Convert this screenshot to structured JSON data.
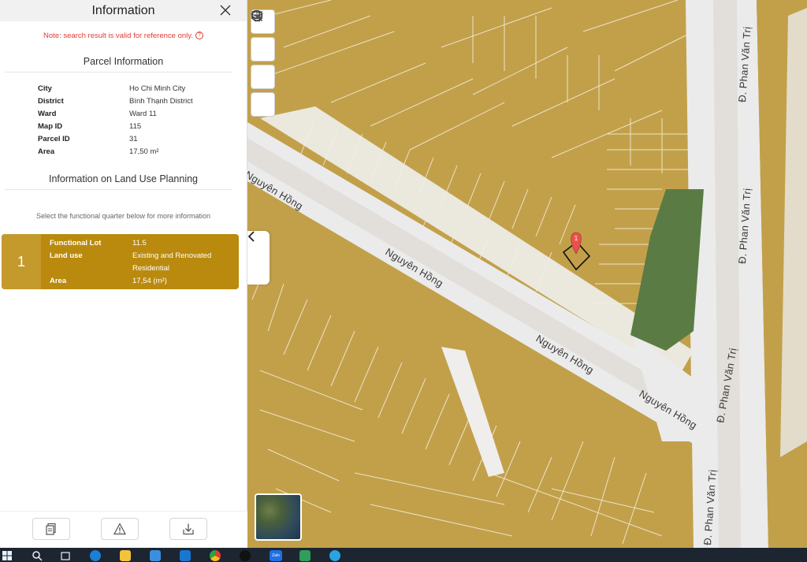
{
  "panel": {
    "title": "Information",
    "note": "Note: search result is valid for reference only.",
    "note_help": "?",
    "parcel_section_title": "Parcel Information",
    "parcel_info": [
      {
        "key": "City",
        "value": "Ho Chi Minh City"
      },
      {
        "key": "District",
        "value": "Bình Thạnh District"
      },
      {
        "key": "Ward",
        "value": "Ward 11"
      },
      {
        "key": "Map ID",
        "value": "115"
      },
      {
        "key": "Parcel ID",
        "value": "31"
      },
      {
        "key": "Area",
        "value": "17,50 m²"
      }
    ],
    "planning_section_title": "Information on Land Use Planning",
    "planning_hint": "Select the functional quarter below for more information",
    "lot": {
      "number": "1",
      "rows": [
        {
          "key": "Functional Lot",
          "value": "11.5"
        },
        {
          "key": "Land use",
          "value": "Existing and Renovated Residential"
        },
        {
          "key": "Area",
          "value": "17,54 (m²)"
        }
      ]
    },
    "footer_buttons": [
      {
        "name": "copy-document-button",
        "icon": "document-icon"
      },
      {
        "name": "report-issue-button",
        "icon": "warning-icon"
      },
      {
        "name": "download-button",
        "icon": "download-icon"
      }
    ]
  },
  "map": {
    "street_labels": [
      "Nguyên Hồng",
      "Nguyên Hồng",
      "Nguyên Hồng",
      "Nguyên Hồng",
      "Đ. Phan Văn Trị",
      "Đ. Phan Văn Trị",
      "Đ. Phan Văn Trị",
      "Đ. Phan Văn Trị"
    ],
    "marker_label": "1",
    "tools": [
      "search-icon",
      "layers-icon",
      "list-icon",
      "info-icon"
    ],
    "colors": {
      "land_residential": "#c2a04a",
      "road": "#ebebeb",
      "green_space": "#5b7b45",
      "marker": "#e8524b",
      "lot_card": "#b98a0d",
      "note_text": "#e53935"
    }
  },
  "taskbar": {
    "apps": [
      "windows-start-icon",
      "search-icon",
      "task-view-icon",
      "edge-icon",
      "file-explorer-icon",
      "store-icon",
      "mail-icon",
      "chrome-icon",
      "tiktok-icon",
      "zalo-icon",
      "app-icon",
      "telegram-icon"
    ],
    "zalo_label": "Zalo"
  }
}
